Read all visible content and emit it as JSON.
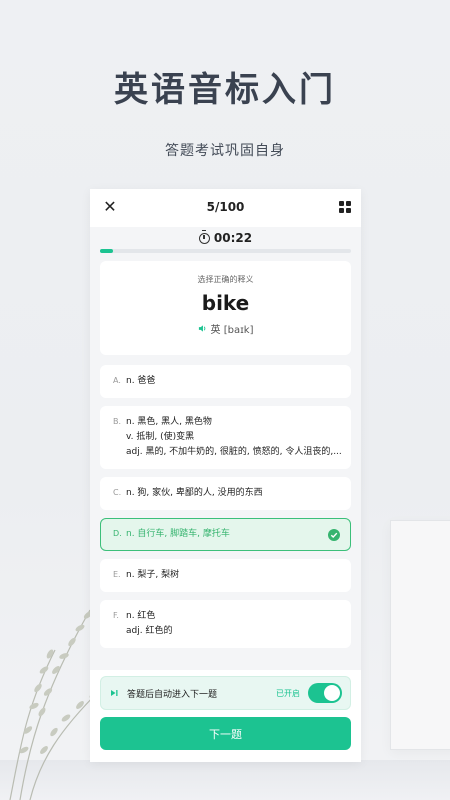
{
  "hero": {
    "title": "英语音标入门",
    "subtitle": "答题考试巩固自身"
  },
  "header": {
    "close_icon": "close-icon",
    "counter": "5/100",
    "menu_icon": "grid-icon"
  },
  "timer": {
    "icon": "clock-icon",
    "time": "00:22"
  },
  "progress": {
    "fraction": 0.05,
    "color": "#1cc391"
  },
  "question": {
    "prompt": "选择正确的释义",
    "word": "bike",
    "speaker_icon": "speaker-icon",
    "phonetic": "英 [baɪk]"
  },
  "options": [
    {
      "letter": "A.",
      "lines": [
        "n. 爸爸"
      ]
    },
    {
      "letter": "B.",
      "lines": [
        "n. 黑色, 黑人, 黑色物",
        "v. 抵制, (使)变黑",
        "adj. 黑的, 不加牛奶的, 很脏的, 愤怒的, 令人沮丧的,..."
      ]
    },
    {
      "letter": "C.",
      "lines": [
        "n. 狗, 家伙, 卑鄙的人, 没用的东西"
      ]
    },
    {
      "letter": "D.",
      "lines": [
        "n. 自行车, 脚踏车, 摩托车"
      ],
      "correct": true
    },
    {
      "letter": "E.",
      "lines": [
        "n. 梨子, 梨树"
      ]
    },
    {
      "letter": "F.",
      "lines": [
        "n. 红色",
        "adj. 红色的"
      ]
    }
  ],
  "bottom": {
    "auto_label": "答题后自动进入下一题",
    "auto_status": "已开启",
    "auto_enabled": true,
    "next_label": "下一题"
  },
  "colors": {
    "accent": "#1cc391",
    "correct": "#36b46f",
    "correct_bg": "#e4f6ec"
  }
}
